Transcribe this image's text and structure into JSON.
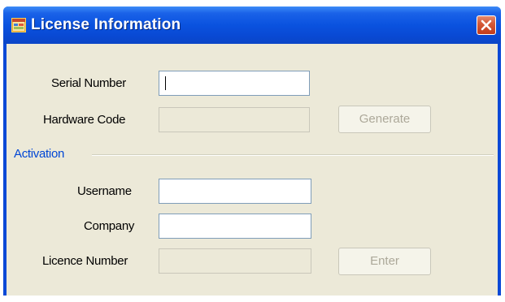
{
  "window": {
    "title": "License Information",
    "icon": "app-window-icon",
    "close_icon": "close-icon"
  },
  "form": {
    "serial_number": {
      "label": "Serial Number",
      "value": ""
    },
    "hardware_code": {
      "label": "Hardware Code",
      "value": ""
    },
    "generate_button": "Generate"
  },
  "activation": {
    "group_label": "Activation",
    "username": {
      "label": "Username",
      "value": ""
    },
    "company": {
      "label": "Company",
      "value": ""
    },
    "licence_number": {
      "label": "Licence Number",
      "value": ""
    },
    "enter_button": "Enter"
  },
  "colors": {
    "titlebar": "#0a52df",
    "client_bg": "#ece9d8",
    "group_label": "#0046d5",
    "close_button": "#d55a38"
  }
}
